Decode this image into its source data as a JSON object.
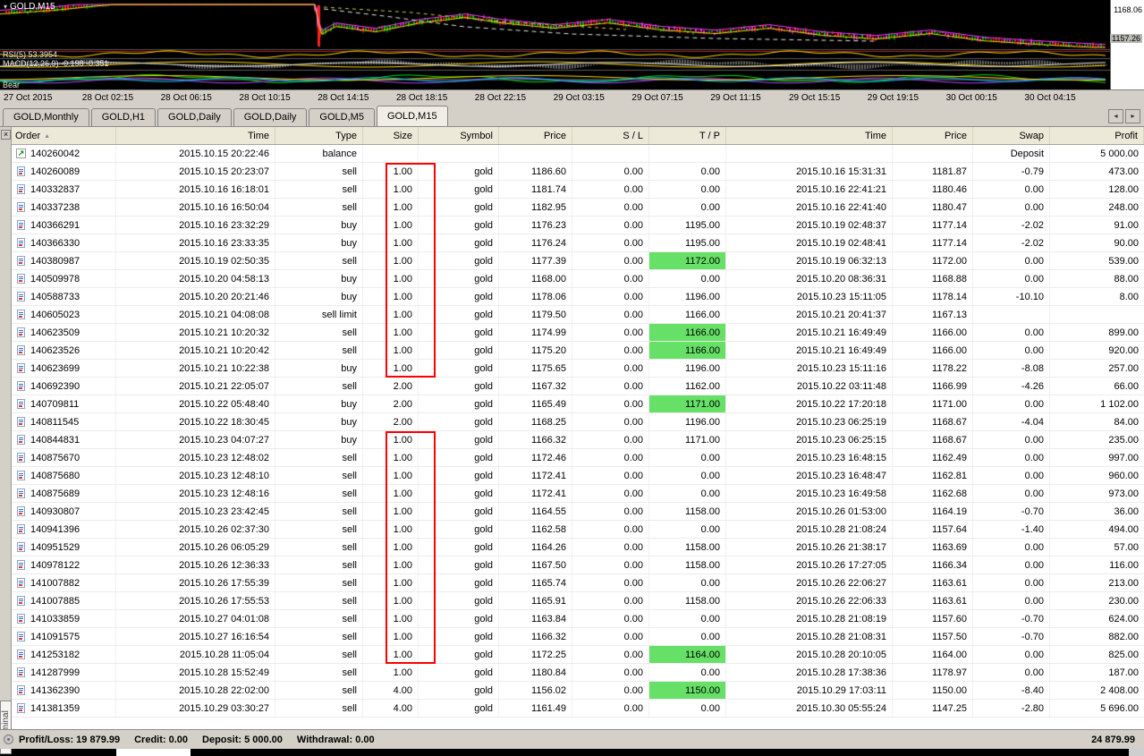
{
  "chart": {
    "symbol": "GOLD,M15",
    "dropdown_icon": "▾",
    "indicators": {
      "rsi": "RSI(5) 53.3954",
      "macd": "MACD(12,26,9) -0.198 -0.351",
      "pane3": "Bear"
    },
    "price_labels": [
      "1168.06",
      "1157.26"
    ],
    "timeline": [
      "27 Oct 2015",
      "28 Oct 02:15",
      "28 Oct 06:15",
      "28 Oct 10:15",
      "28 Oct 14:15",
      "28 Oct 18:15",
      "28 Oct 22:15",
      "29 Oct 03:15",
      "29 Oct 07:15",
      "29 Oct 11:15",
      "29 Oct 15:15",
      "29 Oct 19:15",
      "30 Oct 00:15",
      "30 Oct 04:15"
    ]
  },
  "tabs": {
    "items": [
      "GOLD,Monthly",
      "GOLD,H1",
      "GOLD,Daily",
      "GOLD,Daily",
      "GOLD,M5",
      "GOLD,M15"
    ],
    "active": "GOLD,M15",
    "scroll_left_icon": "◂",
    "scroll_right_icon": "▸"
  },
  "terminal": {
    "tab_label": "Terminal",
    "close_icon": "×",
    "sort_icon": "▲",
    "balance_icon": "↗",
    "columns": [
      "Order",
      "Time",
      "Type",
      "Size",
      "Symbol",
      "Price",
      "S / L",
      "T / P",
      "Time",
      "Price",
      "Swap",
      "Profit"
    ],
    "rows": [
      {
        "icon": "balance",
        "order": "140260042",
        "time": "2015.10.15 20:22:46",
        "type": "balance",
        "size": "",
        "symbol": "",
        "price": "",
        "sl": "",
        "tp": "",
        "tp_hit": false,
        "close_time": "",
        "close_price": "",
        "swap": "Deposit",
        "profit": "5 000.00"
      },
      {
        "icon": "trade",
        "order": "140260089",
        "time": "2015.10.15 20:23:07",
        "type": "sell",
        "size": "1.00",
        "symbol": "gold",
        "price": "1186.60",
        "sl": "0.00",
        "tp": "0.00",
        "tp_hit": false,
        "close_time": "2015.10.16 15:31:31",
        "close_price": "1181.87",
        "swap": "-0.79",
        "profit": "473.00"
      },
      {
        "icon": "trade",
        "order": "140332837",
        "time": "2015.10.16 16:18:01",
        "type": "sell",
        "size": "1.00",
        "symbol": "gold",
        "price": "1181.74",
        "sl": "0.00",
        "tp": "0.00",
        "tp_hit": false,
        "close_time": "2015.10.16 22:41:21",
        "close_price": "1180.46",
        "swap": "0.00",
        "profit": "128.00"
      },
      {
        "icon": "trade",
        "order": "140337238",
        "time": "2015.10.16 16:50:04",
        "type": "sell",
        "size": "1.00",
        "symbol": "gold",
        "price": "1182.95",
        "sl": "0.00",
        "tp": "0.00",
        "tp_hit": false,
        "close_time": "2015.10.16 22:41:40",
        "close_price": "1180.47",
        "swap": "0.00",
        "profit": "248.00"
      },
      {
        "icon": "trade",
        "order": "140366291",
        "time": "2015.10.16 23:32:29",
        "type": "buy",
        "size": "1.00",
        "symbol": "gold",
        "price": "1176.23",
        "sl": "0.00",
        "tp": "1195.00",
        "tp_hit": false,
        "close_time": "2015.10.19 02:48:37",
        "close_price": "1177.14",
        "swap": "-2.02",
        "profit": "91.00"
      },
      {
        "icon": "trade",
        "order": "140366330",
        "time": "2015.10.16 23:33:35",
        "type": "buy",
        "size": "1.00",
        "symbol": "gold",
        "price": "1176.24",
        "sl": "0.00",
        "tp": "1195.00",
        "tp_hit": false,
        "close_time": "2015.10.19 02:48:41",
        "close_price": "1177.14",
        "swap": "-2.02",
        "profit": "90.00"
      },
      {
        "icon": "trade",
        "order": "140380987",
        "time": "2015.10.19 02:50:35",
        "type": "sell",
        "size": "1.00",
        "symbol": "gold",
        "price": "1177.39",
        "sl": "0.00",
        "tp": "1172.00",
        "tp_hit": true,
        "close_time": "2015.10.19 06:32:13",
        "close_price": "1172.00",
        "swap": "0.00",
        "profit": "539.00"
      },
      {
        "icon": "trade",
        "order": "140509978",
        "time": "2015.10.20 04:58:13",
        "type": "buy",
        "size": "1.00",
        "symbol": "gold",
        "price": "1168.00",
        "sl": "0.00",
        "tp": "0.00",
        "tp_hit": false,
        "close_time": "2015.10.20 08:36:31",
        "close_price": "1168.88",
        "swap": "0.00",
        "profit": "88.00"
      },
      {
        "icon": "trade",
        "order": "140588733",
        "time": "2015.10.20 20:21:46",
        "type": "buy",
        "size": "1.00",
        "symbol": "gold",
        "price": "1178.06",
        "sl": "0.00",
        "tp": "1196.00",
        "tp_hit": false,
        "close_time": "2015.10.23 15:11:05",
        "close_price": "1178.14",
        "swap": "-10.10",
        "profit": "8.00"
      },
      {
        "icon": "trade",
        "order": "140605023",
        "time": "2015.10.21 04:08:08",
        "type": "sell limit",
        "size": "1.00",
        "symbol": "gold",
        "price": "1179.50",
        "sl": "0.00",
        "tp": "1166.00",
        "tp_hit": false,
        "close_time": "2015.10.21 20:41:37",
        "close_price": "1167.13",
        "swap": "",
        "profit": ""
      },
      {
        "icon": "trade",
        "order": "140623509",
        "time": "2015.10.21 10:20:32",
        "type": "sell",
        "size": "1.00",
        "symbol": "gold",
        "price": "1174.99",
        "sl": "0.00",
        "tp": "1166.00",
        "tp_hit": true,
        "close_time": "2015.10.21 16:49:49",
        "close_price": "1166.00",
        "swap": "0.00",
        "profit": "899.00"
      },
      {
        "icon": "trade",
        "order": "140623526",
        "time": "2015.10.21 10:20:42",
        "type": "sell",
        "size": "1.00",
        "symbol": "gold",
        "price": "1175.20",
        "sl": "0.00",
        "tp": "1166.00",
        "tp_hit": true,
        "close_time": "2015.10.21 16:49:49",
        "close_price": "1166.00",
        "swap": "0.00",
        "profit": "920.00"
      },
      {
        "icon": "trade",
        "order": "140623699",
        "time": "2015.10.21 10:22:38",
        "type": "buy",
        "size": "1.00",
        "symbol": "gold",
        "price": "1175.65",
        "sl": "0.00",
        "tp": "1196.00",
        "tp_hit": false,
        "close_time": "2015.10.23 15:11:16",
        "close_price": "1178.22",
        "swap": "-8.08",
        "profit": "257.00"
      },
      {
        "icon": "trade",
        "order": "140692390",
        "time": "2015.10.21 22:05:07",
        "type": "sell",
        "size": "2.00",
        "symbol": "gold",
        "price": "1167.32",
        "sl": "0.00",
        "tp": "1162.00",
        "tp_hit": false,
        "close_time": "2015.10.22 03:11:48",
        "close_price": "1166.99",
        "swap": "-4.26",
        "profit": "66.00"
      },
      {
        "icon": "trade",
        "order": "140709811",
        "time": "2015.10.22 05:48:40",
        "type": "buy",
        "size": "2.00",
        "symbol": "gold",
        "price": "1165.49",
        "sl": "0.00",
        "tp": "1171.00",
        "tp_hit": true,
        "close_time": "2015.10.22 17:20:18",
        "close_price": "1171.00",
        "swap": "0.00",
        "profit": "1 102.00"
      },
      {
        "icon": "trade",
        "order": "140811545",
        "time": "2015.10.22 18:30:45",
        "type": "buy",
        "size": "2.00",
        "symbol": "gold",
        "price": "1168.25",
        "sl": "0.00",
        "tp": "1196.00",
        "tp_hit": false,
        "close_time": "2015.10.23 06:25:19",
        "close_price": "1168.67",
        "swap": "-4.04",
        "profit": "84.00"
      },
      {
        "icon": "trade",
        "order": "140844831",
        "time": "2015.10.23 04:07:27",
        "type": "buy",
        "size": "1.00",
        "symbol": "gold",
        "price": "1166.32",
        "sl": "0.00",
        "tp": "1171.00",
        "tp_hit": false,
        "close_time": "2015.10.23 06:25:15",
        "close_price": "1168.67",
        "swap": "0.00",
        "profit": "235.00"
      },
      {
        "icon": "trade",
        "order": "140875670",
        "time": "2015.10.23 12:48:02",
        "type": "sell",
        "size": "1.00",
        "symbol": "gold",
        "price": "1172.46",
        "sl": "0.00",
        "tp": "0.00",
        "tp_hit": false,
        "close_time": "2015.10.23 16:48:15",
        "close_price": "1162.49",
        "swap": "0.00",
        "profit": "997.00"
      },
      {
        "icon": "trade",
        "order": "140875680",
        "time": "2015.10.23 12:48:10",
        "type": "sell",
        "size": "1.00",
        "symbol": "gold",
        "price": "1172.41",
        "sl": "0.00",
        "tp": "0.00",
        "tp_hit": false,
        "close_time": "2015.10.23 16:48:47",
        "close_price": "1162.81",
        "swap": "0.00",
        "profit": "960.00"
      },
      {
        "icon": "trade",
        "order": "140875689",
        "time": "2015.10.23 12:48:16",
        "type": "sell",
        "size": "1.00",
        "symbol": "gold",
        "price": "1172.41",
        "sl": "0.00",
        "tp": "0.00",
        "tp_hit": false,
        "close_time": "2015.10.23 16:49:58",
        "close_price": "1162.68",
        "swap": "0.00",
        "profit": "973.00"
      },
      {
        "icon": "trade",
        "order": "140930807",
        "time": "2015.10.23 23:42:45",
        "type": "sell",
        "size": "1.00",
        "symbol": "gold",
        "price": "1164.55",
        "sl": "0.00",
        "tp": "1158.00",
        "tp_hit": false,
        "close_time": "2015.10.26 01:53:00",
        "close_price": "1164.19",
        "swap": "-0.70",
        "profit": "36.00"
      },
      {
        "icon": "trade",
        "order": "140941396",
        "time": "2015.10.26 02:37:30",
        "type": "sell",
        "size": "1.00",
        "symbol": "gold",
        "price": "1162.58",
        "sl": "0.00",
        "tp": "0.00",
        "tp_hit": false,
        "close_time": "2015.10.28 21:08:24",
        "close_price": "1157.64",
        "swap": "-1.40",
        "profit": "494.00"
      },
      {
        "icon": "trade",
        "order": "140951529",
        "time": "2015.10.26 06:05:29",
        "type": "sell",
        "size": "1.00",
        "symbol": "gold",
        "price": "1164.26",
        "sl": "0.00",
        "tp": "1158.00",
        "tp_hit": false,
        "close_time": "2015.10.26 21:38:17",
        "close_price": "1163.69",
        "swap": "0.00",
        "profit": "57.00"
      },
      {
        "icon": "trade",
        "order": "140978122",
        "time": "2015.10.26 12:36:33",
        "type": "sell",
        "size": "1.00",
        "symbol": "gold",
        "price": "1167.50",
        "sl": "0.00",
        "tp": "1158.00",
        "tp_hit": false,
        "close_time": "2015.10.26 17:27:05",
        "close_price": "1166.34",
        "swap": "0.00",
        "profit": "116.00"
      },
      {
        "icon": "trade",
        "order": "141007882",
        "time": "2015.10.26 17:55:39",
        "type": "sell",
        "size": "1.00",
        "symbol": "gold",
        "price": "1165.74",
        "sl": "0.00",
        "tp": "0.00",
        "tp_hit": false,
        "close_time": "2015.10.26 22:06:27",
        "close_price": "1163.61",
        "swap": "0.00",
        "profit": "213.00"
      },
      {
        "icon": "trade",
        "order": "141007885",
        "time": "2015.10.26 17:55:53",
        "type": "sell",
        "size": "1.00",
        "symbol": "gold",
        "price": "1165.91",
        "sl": "0.00",
        "tp": "1158.00",
        "tp_hit": false,
        "close_time": "2015.10.26 22:06:33",
        "close_price": "1163.61",
        "swap": "0.00",
        "profit": "230.00"
      },
      {
        "icon": "trade",
        "order": "141033859",
        "time": "2015.10.27 04:01:08",
        "type": "sell",
        "size": "1.00",
        "symbol": "gold",
        "price": "1163.84",
        "sl": "0.00",
        "tp": "0.00",
        "tp_hit": false,
        "close_time": "2015.10.28 21:08:19",
        "close_price": "1157.60",
        "swap": "-0.70",
        "profit": "624.00"
      },
      {
        "icon": "trade",
        "order": "141091575",
        "time": "2015.10.27 16:16:54",
        "type": "sell",
        "size": "1.00",
        "symbol": "gold",
        "price": "1166.32",
        "sl": "0.00",
        "tp": "0.00",
        "tp_hit": false,
        "close_time": "2015.10.28 21:08:31",
        "close_price": "1157.50",
        "swap": "-0.70",
        "profit": "882.00"
      },
      {
        "icon": "trade",
        "order": "141253182",
        "time": "2015.10.28 11:05:04",
        "type": "sell",
        "size": "1.00",
        "symbol": "gold",
        "price": "1172.25",
        "sl": "0.00",
        "tp": "1164.00",
        "tp_hit": true,
        "close_time": "2015.10.28 20:10:05",
        "close_price": "1164.00",
        "swap": "0.00",
        "profit": "825.00"
      },
      {
        "icon": "trade",
        "order": "141287999",
        "time": "2015.10.28 15:52:49",
        "type": "sell",
        "size": "1.00",
        "symbol": "gold",
        "price": "1180.84",
        "sl": "0.00",
        "tp": "0.00",
        "tp_hit": false,
        "close_time": "2015.10.28 17:38:36",
        "close_price": "1178.97",
        "swap": "0.00",
        "profit": "187.00"
      },
      {
        "icon": "trade",
        "order": "141362390",
        "time": "2015.10.28 22:02:00",
        "type": "sell",
        "size": "4.00",
        "symbol": "gold",
        "price": "1156.02",
        "sl": "0.00",
        "tp": "1150.00",
        "tp_hit": true,
        "close_time": "2015.10.29 17:03:11",
        "close_price": "1150.00",
        "swap": "-8.40",
        "profit": "2 408.00"
      },
      {
        "icon": "trade",
        "order": "141381359",
        "time": "2015.10.29 03:30:27",
        "type": "sell",
        "size": "4.00",
        "symbol": "gold",
        "price": "1161.49",
        "sl": "0.00",
        "tp": "0.00",
        "tp_hit": false,
        "close_time": "2015.10.30 05:55:24",
        "close_price": "1147.25",
        "swap": "-2.80",
        "profit": "5 696.00"
      }
    ],
    "status": {
      "parts": [
        "Profit/Loss: 19 879.99",
        "Credit: 0.00",
        "Deposit: 5 000.00",
        "Withdrawal: 0.00"
      ],
      "total": "24 879.99"
    }
  },
  "colors": {
    "tp_hit_green": "#67e067",
    "annotation_red": "#ff0000",
    "chrome_gray": "#d4d0c8",
    "chart_background": "#000000"
  }
}
